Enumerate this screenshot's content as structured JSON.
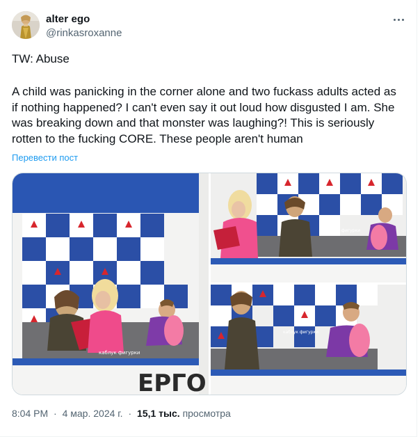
{
  "tweet": {
    "display_name": "alter ego",
    "handle": "@rinkasroxanne",
    "more_icon": "more-horizontal-icon",
    "line_tw": "TW: Abuse",
    "body": "A child was panicking in the corner alone and two fuckass adults acted as if nothing happened? I can't even say it out loud how disgusted I am. She was breaking down and that monster was laughing?! This is seriously rotten to the fucking CORE. These people aren't human",
    "translate_label": "Перевести пост",
    "time": "8:04 PM",
    "date": "4 мар. 2024 г.",
    "views_count": "15,1 тыс.",
    "views_label": "просмотра",
    "separator": "·"
  },
  "media": {
    "watermark": "каблук фигурки",
    "banner_text": "ЕРГО"
  },
  "colors": {
    "link": "#1d9bf0",
    "secondary_text": "#536471",
    "wall_blue": "#2b4fa6",
    "pink_jacket": "#f0508e"
  }
}
